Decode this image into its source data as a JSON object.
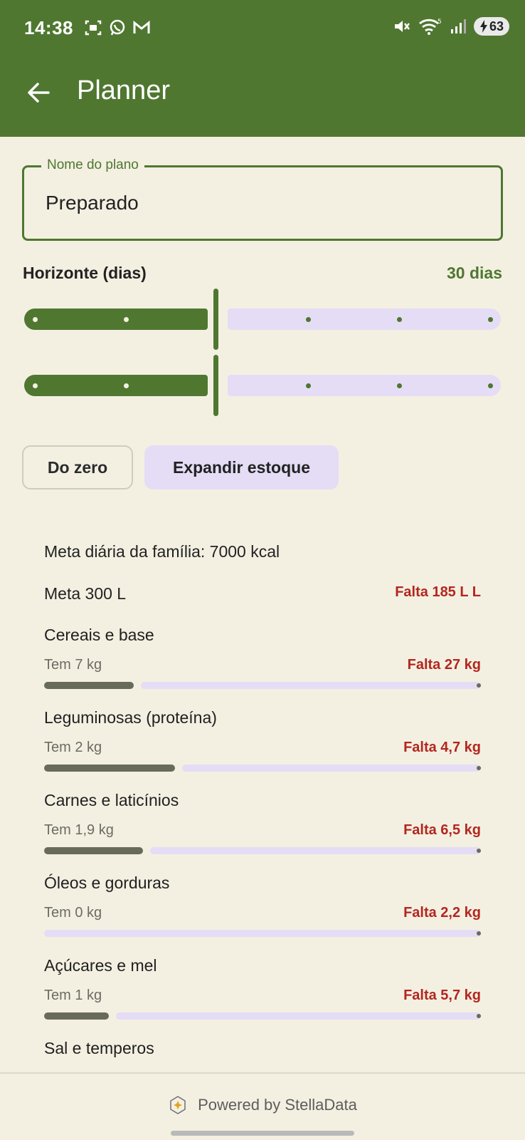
{
  "status_bar": {
    "time": "14:38",
    "battery": "63"
  },
  "appbar": {
    "title": "Planner"
  },
  "plan_name": {
    "label": "Nome do plano",
    "value": "Preparado"
  },
  "horizon": {
    "label": "Horizonte (dias)",
    "value_text": "30 dias"
  },
  "chips": {
    "from_zero": "Do zero",
    "expand_stock": "Expandir estoque"
  },
  "summary": {
    "daily_goal": "Meta diária da família: 7000 kcal",
    "water_goal": "Meta 300 L",
    "water_missing": "Falta 185 L L"
  },
  "categories": [
    {
      "title": "Cereais e base",
      "have": "Tem 7 kg",
      "missing": "Falta 27 kg",
      "fraction": 0.206
    },
    {
      "title": "Leguminosas (proteína)",
      "have": "Tem 2 kg",
      "missing": "Falta 4,7 kg",
      "fraction": 0.299
    },
    {
      "title": "Carnes e laticínios",
      "have": "Tem 1,9 kg",
      "missing": "Falta 6,5 kg",
      "fraction": 0.226
    },
    {
      "title": "Óleos e gorduras",
      "have": "Tem 0 kg",
      "missing": "Falta 2,2 kg",
      "fraction": 0.0
    },
    {
      "title": "Açúcares e mel",
      "have": "Tem 1 kg",
      "missing": "Falta 5,7 kg",
      "fraction": 0.149
    },
    {
      "title": "Sal e temperos",
      "have": "",
      "missing": "",
      "fraction": 0
    }
  ],
  "footer": {
    "powered": "Powered by StellaData"
  },
  "colors": {
    "primary": "#4F7730",
    "error": "#B3261E",
    "track": "#E5DDF6",
    "background": "#F3F0E2"
  }
}
